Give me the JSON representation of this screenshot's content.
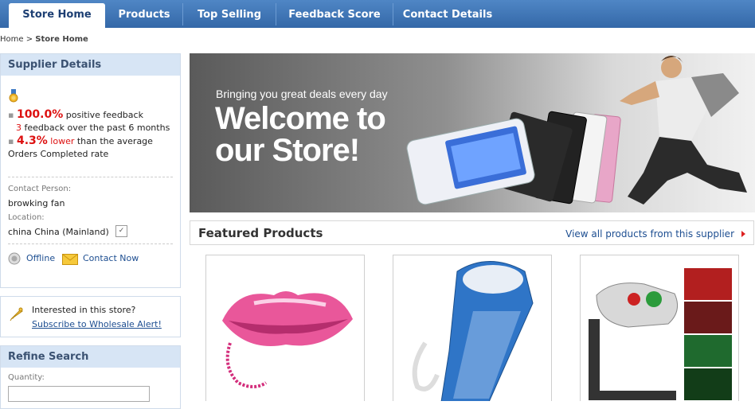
{
  "nav": {
    "tabs": [
      "Store Home",
      "Products",
      "Top Selling",
      "Feedback Score",
      "Contact Details"
    ],
    "active": "Store Home"
  },
  "breadcrumb": {
    "home": "Home",
    "sep": ">",
    "current": "Store Home"
  },
  "supplier": {
    "title": "Supplier Details",
    "feedback_pct": "100.0%",
    "feedback_text": "positive feedback",
    "feedback_count": "3",
    "feedback_period": "feedback over the past 6 months",
    "orders_pct": "4.3%",
    "orders_lower": "lower",
    "orders_text": "than the average Orders Completed rate",
    "contact_label": "Contact Person:",
    "contact_value": "browking fan",
    "location_label": "Location:",
    "location_value": "china China (Mainland)",
    "status": "Offline",
    "contact_now": "Contact Now"
  },
  "alert": {
    "question": "Interested in this store?",
    "link": "Subscribe to Wholesale Alert!"
  },
  "refine": {
    "title": "Refine Search",
    "quantity_label": "Quantity:",
    "quantity_value": ""
  },
  "banner": {
    "tagline": "Bringing you great deals every day",
    "headline1": "Welcome to",
    "headline2": "our Store!"
  },
  "featured": {
    "title": "Featured Products",
    "view_all": "View all products from this supplier"
  },
  "colors": {
    "nav_blue": "#3b72b6",
    "panel_head": "#d7e5f5",
    "accent_red": "#d11111",
    "link_blue": "#1d4e91"
  }
}
